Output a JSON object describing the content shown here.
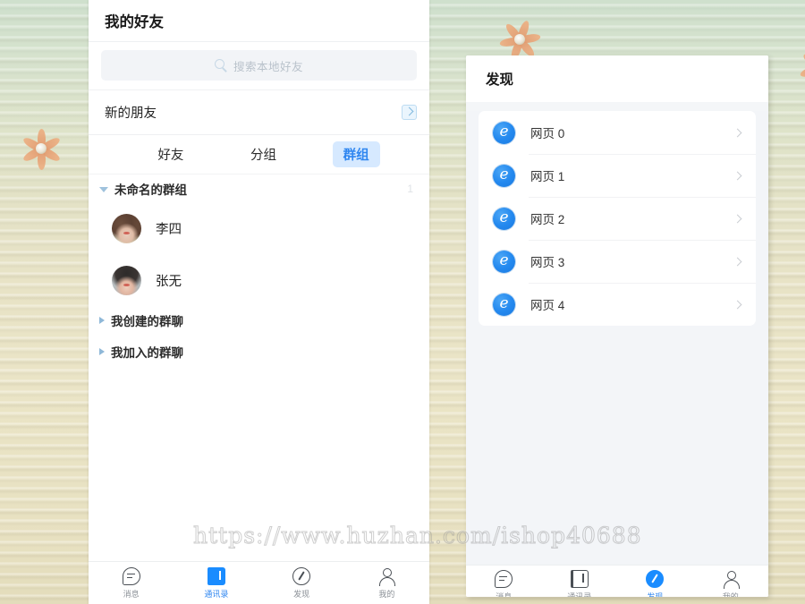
{
  "watermark": "https://www.huzhan.com/ishop40688",
  "background": {
    "base_color": "#e6e2c5",
    "accent_color": "#2f86f0",
    "decorations": [
      {
        "name": "flower-left",
        "icon": "flower-icon"
      },
      {
        "name": "flower-top",
        "icon": "flower-icon"
      },
      {
        "name": "flower-right",
        "icon": "flower-icon"
      }
    ]
  },
  "left_panel": {
    "title": "我的好友",
    "search": {
      "placeholder": "搜索本地好友",
      "value": "",
      "icon": "search-icon"
    },
    "new_friend": {
      "label": "新的朋友",
      "icon": "arrow-right-box-icon"
    },
    "tabs": [
      {
        "label": "好友",
        "active": false
      },
      {
        "label": "分组",
        "active": false
      },
      {
        "label": "群组",
        "active": true
      }
    ],
    "groups": [
      {
        "label": "未命名的群组",
        "count": "1",
        "expanded": true
      },
      {
        "label": "我创建的群聊",
        "count": "",
        "expanded": false
      },
      {
        "label": "我加入的群聊",
        "count": "",
        "expanded": false
      }
    ],
    "contacts": [
      {
        "name": "李四",
        "avatar": "avatar-female-1"
      },
      {
        "name": "张无",
        "avatar": "avatar-female-2"
      }
    ],
    "nav": [
      {
        "label": "消息",
        "icon": "message-icon",
        "active": false
      },
      {
        "label": "通讯录",
        "icon": "contacts-icon",
        "active": true
      },
      {
        "label": "发现",
        "icon": "compass-icon",
        "active": false
      },
      {
        "label": "我的",
        "icon": "person-icon",
        "active": false
      }
    ]
  },
  "right_panel": {
    "title": "发现",
    "items": [
      {
        "label": "网页 0",
        "icon": "ie-browser-icon",
        "glyph": "e",
        "chevron": "chevron-right-icon"
      },
      {
        "label": "网页 1",
        "icon": "ie-browser-icon",
        "glyph": "e",
        "chevron": "chevron-right-icon"
      },
      {
        "label": "网页 2",
        "icon": "ie-browser-icon",
        "glyph": "e",
        "chevron": "chevron-right-icon"
      },
      {
        "label": "网页 3",
        "icon": "ie-browser-icon",
        "glyph": "e",
        "chevron": "chevron-right-icon"
      },
      {
        "label": "网页 4",
        "icon": "ie-browser-icon",
        "glyph": "e",
        "chevron": "chevron-right-icon"
      }
    ],
    "nav": [
      {
        "label": "消息",
        "icon": "message-icon",
        "active": false
      },
      {
        "label": "通讯录",
        "icon": "contacts-icon",
        "active": false
      },
      {
        "label": "发现",
        "icon": "compass-icon",
        "active": true
      },
      {
        "label": "我的",
        "icon": "person-icon",
        "active": false
      }
    ]
  }
}
